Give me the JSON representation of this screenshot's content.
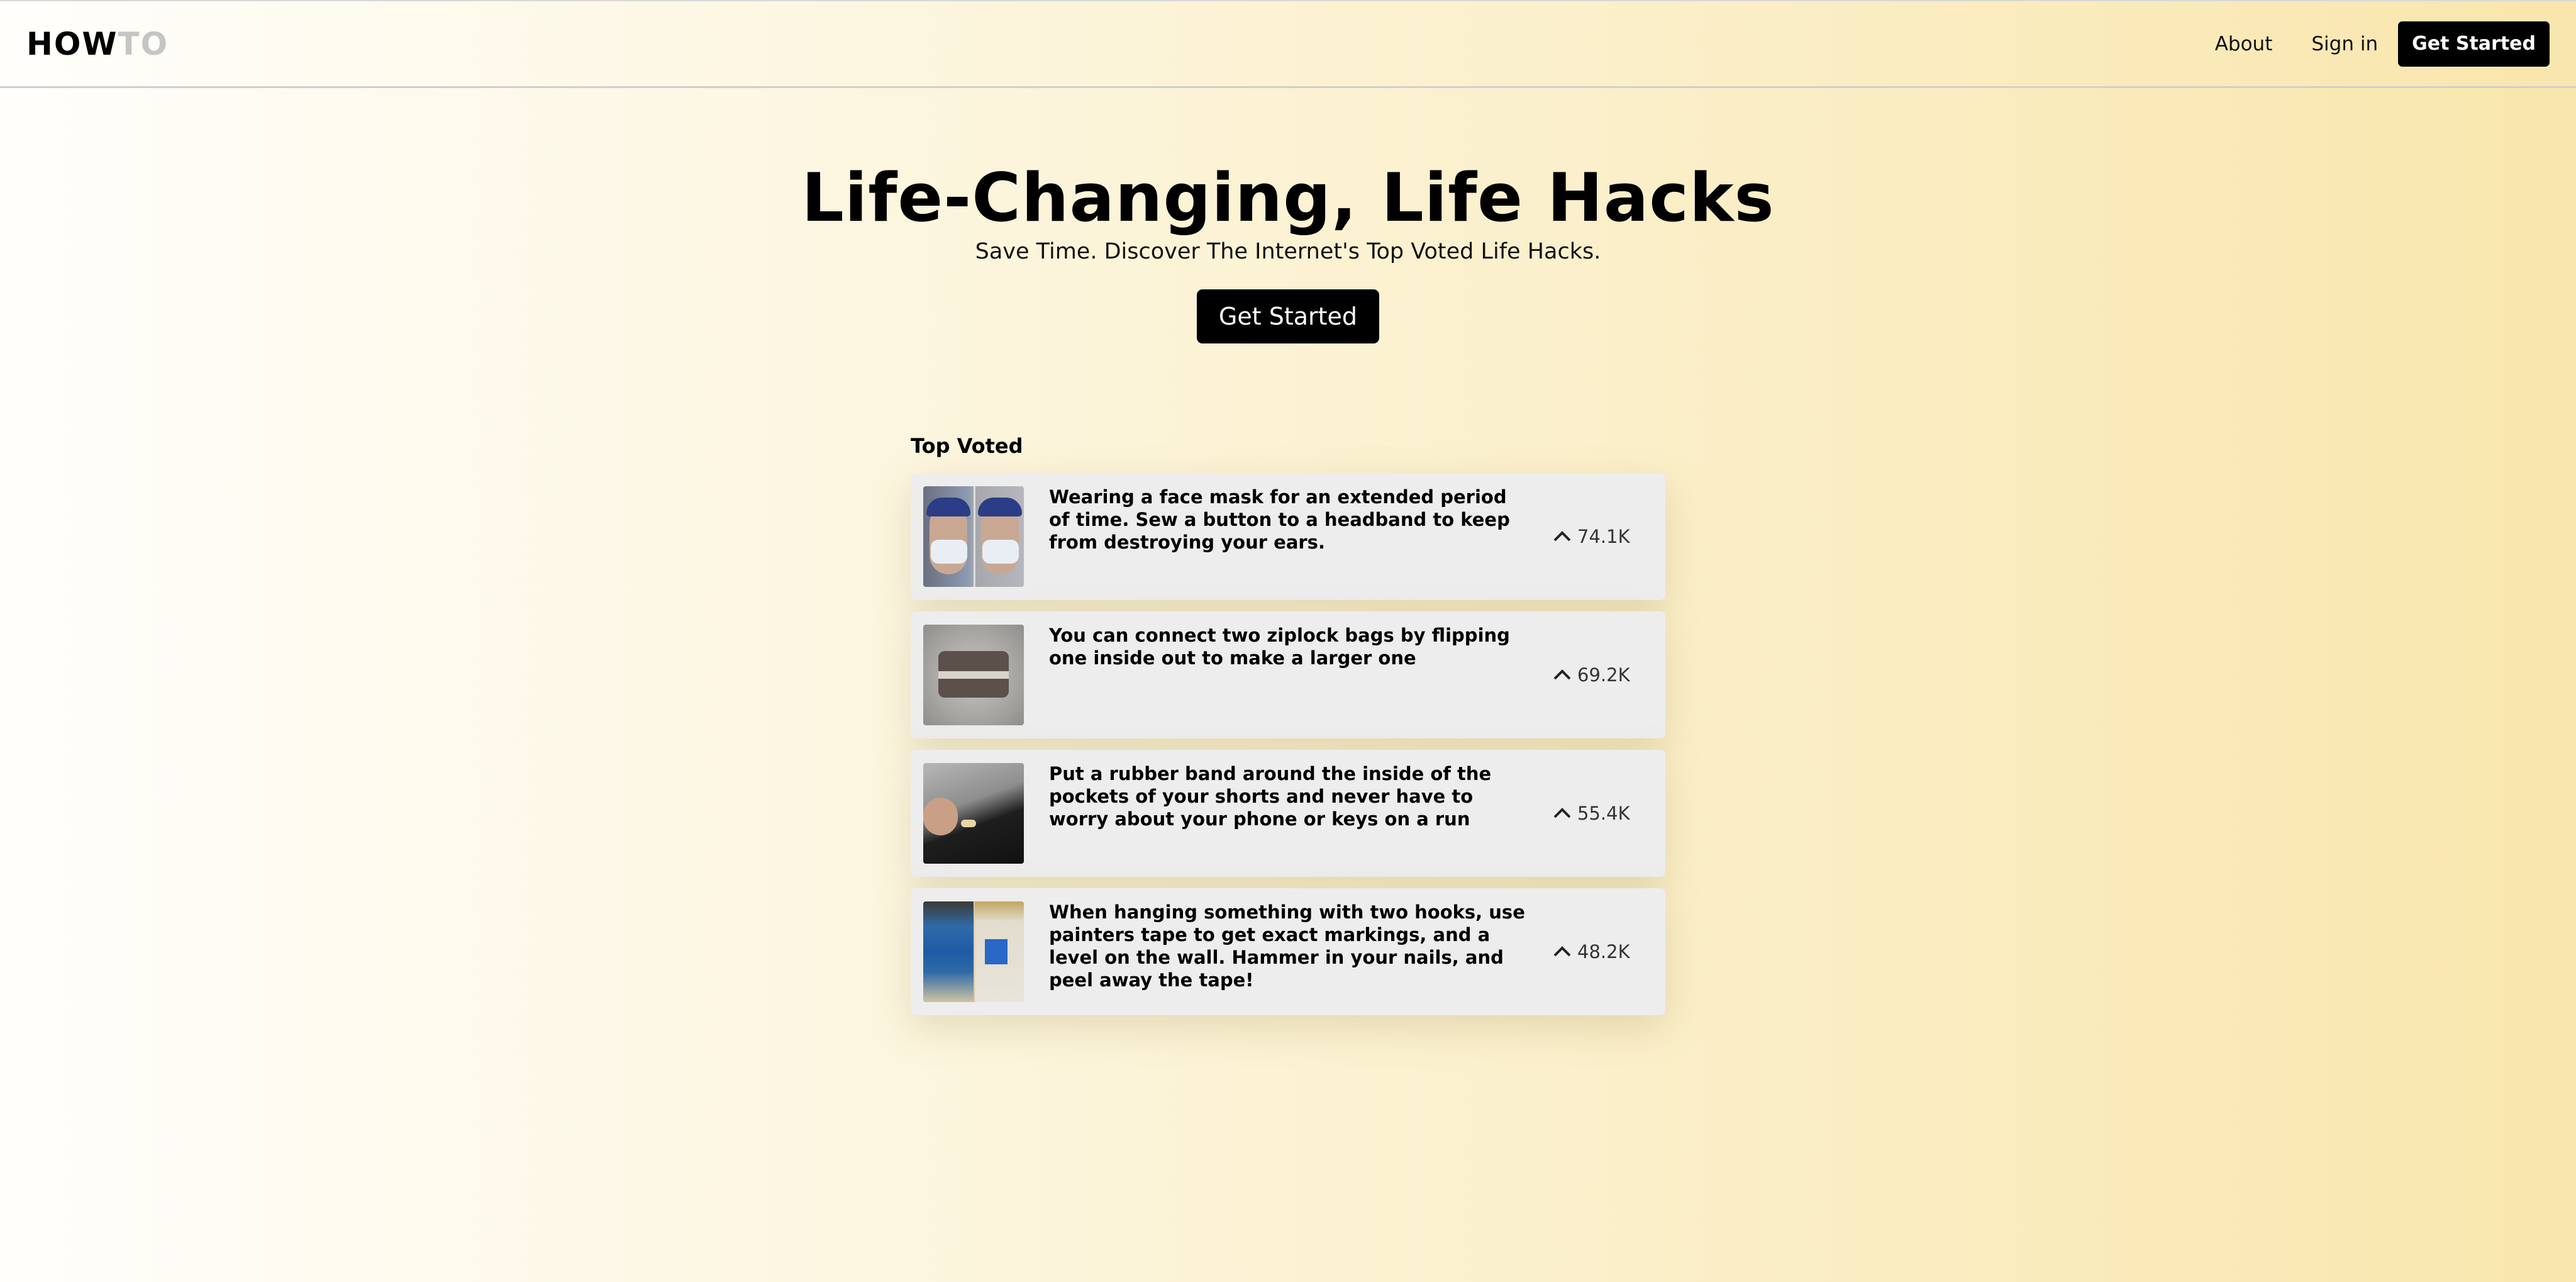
{
  "header": {
    "logo_how": "HOW",
    "logo_to": "TO",
    "nav": {
      "about": "About",
      "signin": "Sign in",
      "get_started": "Get Started"
    }
  },
  "hero": {
    "title": "Life-Changing, Life Hacks",
    "subtitle": "Save Time. Discover The Internet's Top Voted Life Hacks.",
    "cta": "Get Started"
  },
  "top_voted": {
    "title": "Top Voted",
    "items": [
      {
        "text": "Wearing a face mask for an extended period of time. Sew a button to a headband to keep from destroying your ears.",
        "votes": "74.1K",
        "thumb_icon": "face-mask-photo"
      },
      {
        "text": "You can connect two ziplock bags by flipping one inside out to make a larger one",
        "votes": "69.2K",
        "thumb_icon": "ziplock-bag-photo"
      },
      {
        "text": "Put a rubber band around the inside of the pockets of your shorts and never have to worry about your phone or keys on a run",
        "votes": "55.4K",
        "thumb_icon": "shorts-pocket-photo"
      },
      {
        "text": "When hanging something with two hooks, use painters tape to get exact markings, and a level on the wall. Hammer in your nails, and peel away the tape!",
        "votes": "48.2K",
        "thumb_icon": "painters-tape-photo"
      }
    ]
  },
  "colors": {
    "accent": "#000000",
    "background_left": "#fffefb",
    "background_right": "#f9e6ad",
    "card": "#ededed"
  }
}
